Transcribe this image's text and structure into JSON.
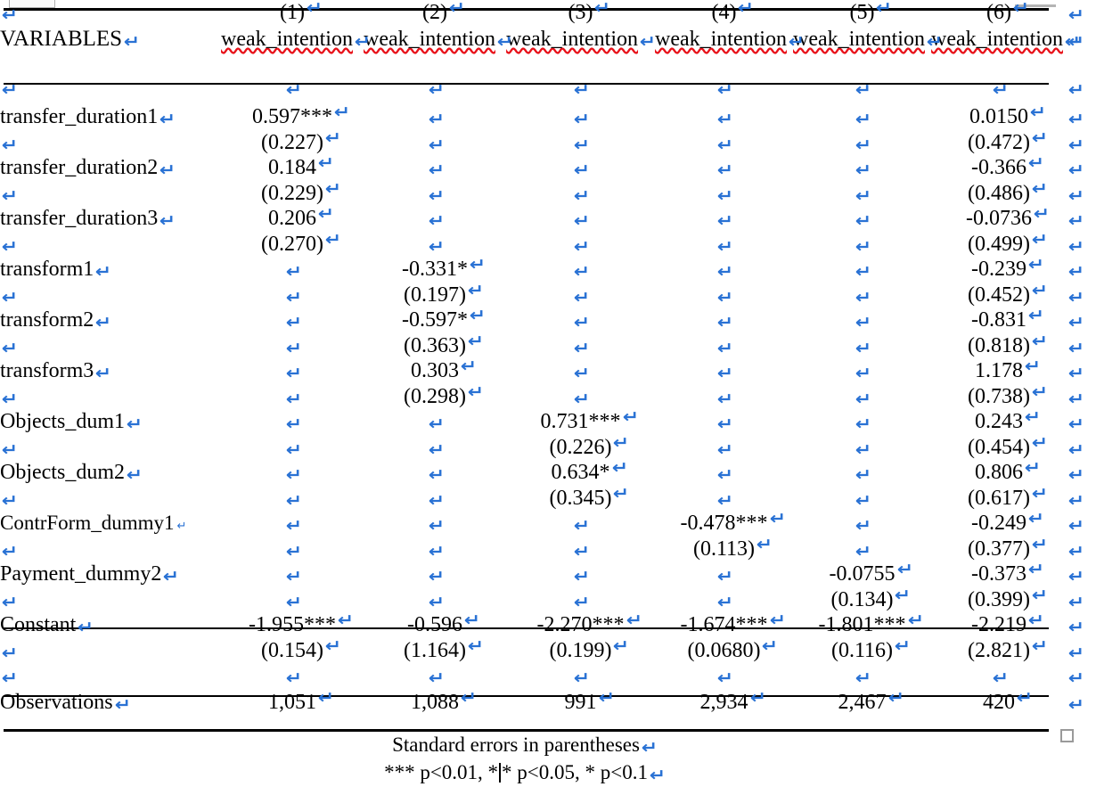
{
  "document": {
    "type": "word-processor-table",
    "formatting_marks_visible": true,
    "paragraph_mark_glyph": "↵",
    "spellcheck_underline_color": "#e8121a"
  },
  "table": {
    "header": {
      "variables_label": "VARIABLES",
      "model_numbers": [
        "(1)",
        "(2)",
        "(3)",
        "(4)",
        "(5)",
        "(6)"
      ],
      "dependent_variables": [
        "weak_intention",
        "weak_intention",
        "weak_intention",
        "weak_intention",
        "weak_intention",
        "weak_intention"
      ]
    },
    "rows": [
      {
        "label": "transfer_duration1",
        "coefficients": [
          "0.597***",
          "",
          "",
          "",
          "",
          "0.0150"
        ],
        "std_errors": [
          "(0.227)",
          "",
          "",
          "",
          "",
          "(0.472)"
        ]
      },
      {
        "label": "transfer_duration2",
        "coefficients": [
          "0.184",
          "",
          "",
          "",
          "",
          "-0.366"
        ],
        "std_errors": [
          "(0.229)",
          "",
          "",
          "",
          "",
          "(0.486)"
        ]
      },
      {
        "label": "transfer_duration3",
        "coefficients": [
          "0.206",
          "",
          "",
          "",
          "",
          "-0.0736"
        ],
        "std_errors": [
          "(0.270)",
          "",
          "",
          "",
          "",
          "(0.499)"
        ]
      },
      {
        "label": "transform1",
        "coefficients": [
          "",
          "-0.331*",
          "",
          "",
          "",
          "-0.239"
        ],
        "std_errors": [
          "",
          "(0.197)",
          "",
          "",
          "",
          "(0.452)"
        ]
      },
      {
        "label": "transform2",
        "coefficients": [
          "",
          "-0.597*",
          "",
          "",
          "",
          "-0.831"
        ],
        "std_errors": [
          "",
          "(0.363)",
          "",
          "",
          "",
          "(0.818)"
        ]
      },
      {
        "label": "transform3",
        "coefficients": [
          "",
          "0.303",
          "",
          "",
          "",
          "1.178"
        ],
        "std_errors": [
          "",
          "(0.298)",
          "",
          "",
          "",
          "(0.738)"
        ]
      },
      {
        "label": "Objects_dum1",
        "coefficients": [
          "",
          "",
          "0.731***",
          "",
          "",
          "0.243"
        ],
        "std_errors": [
          "",
          "",
          "(0.226)",
          "",
          "",
          "(0.454)"
        ]
      },
      {
        "label": "Objects_dum2",
        "coefficients": [
          "",
          "",
          "0.634*",
          "",
          "",
          "0.806"
        ],
        "std_errors": [
          "",
          "",
          "(0.345)",
          "",
          "",
          "(0.617)"
        ]
      },
      {
        "label": "ContrForm_dummy1",
        "label_mark": "small",
        "coefficients": [
          "",
          "",
          "",
          "-0.478***",
          "",
          "-0.249"
        ],
        "std_errors": [
          "",
          "",
          "",
          "(0.113)",
          "",
          "(0.377)"
        ]
      },
      {
        "label": "Payment_dummy2",
        "coefficients": [
          "",
          "",
          "",
          "",
          "-0.0755",
          "-0.373"
        ],
        "std_errors": [
          "",
          "",
          "",
          "",
          "(0.134)",
          "(0.399)"
        ]
      },
      {
        "label": "Constant",
        "coefficients": [
          "-1.955***",
          "-0.596",
          "-2.270***",
          "-1.674***",
          "-1.801***",
          "-2.219"
        ],
        "std_errors": [
          "(0.154)",
          "(1.164)",
          "(0.199)",
          "(0.0680)",
          "(0.116)",
          "(2.821)"
        ]
      }
    ],
    "observations": {
      "label": "Observations",
      "values": [
        "1,051",
        "1,088",
        "991",
        "2,934",
        "2,467",
        "420"
      ]
    }
  },
  "footnotes": {
    "standard_errors_note": "Standard errors in parentheses",
    "significance_note_part1": "*** p<0.01, *",
    "significance_note_part2": "* p<0.05, * p<0.1"
  }
}
